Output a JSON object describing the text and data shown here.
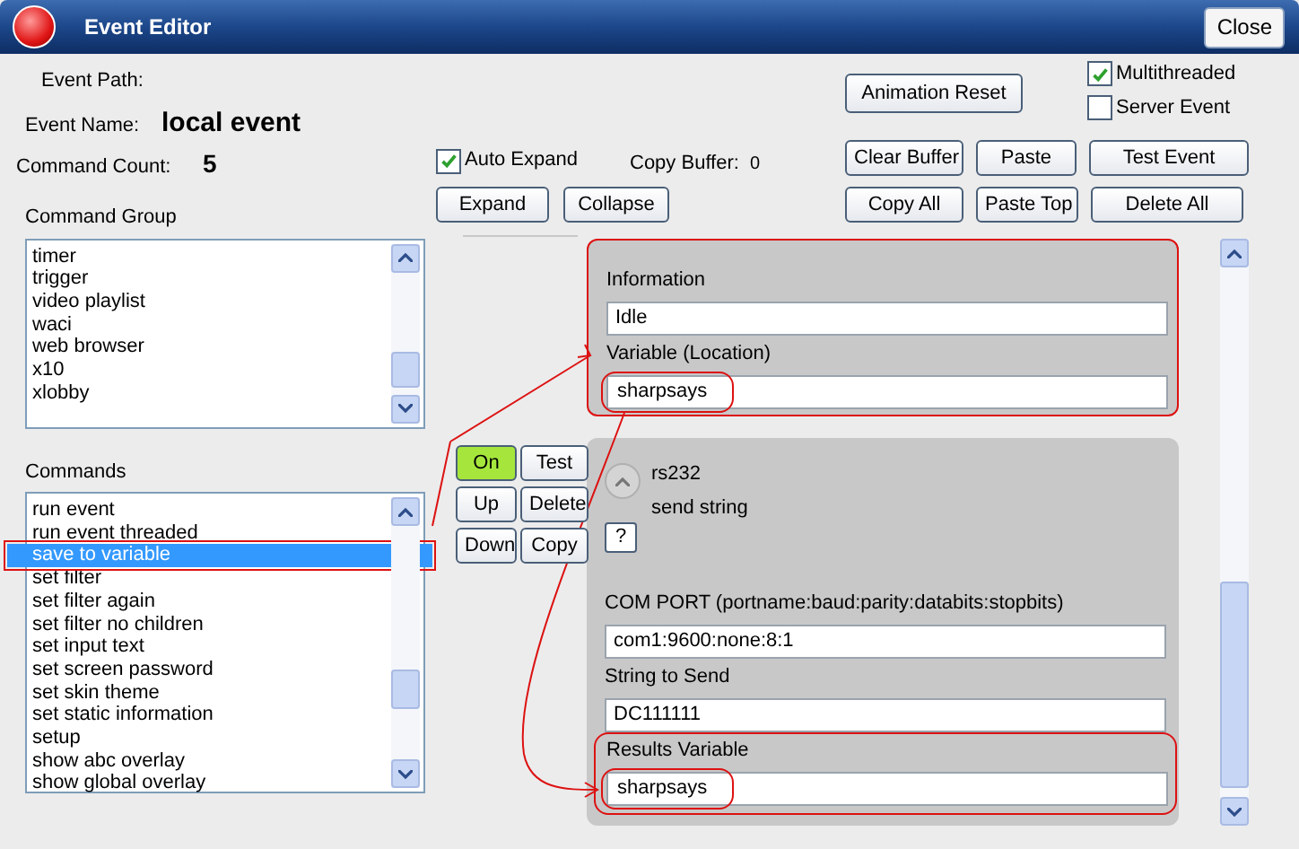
{
  "window": {
    "title": "Event Editor",
    "close_button": "Close"
  },
  "event": {
    "path_label": "Event Path:",
    "name_label": "Event Name:",
    "name": "local event",
    "count_label": "Command Count:",
    "count": "5"
  },
  "command_group": {
    "label": "Command Group",
    "items": [
      {
        "text": "timer",
        "selected": false,
        "marked": false
      },
      {
        "text": "trigger",
        "selected": false,
        "marked": false
      },
      {
        "text": "video playlist",
        "selected": false,
        "marked": false
      },
      {
        "text": "waci",
        "selected": false,
        "marked": false
      },
      {
        "text": "web browser",
        "selected": false,
        "marked": false
      },
      {
        "text": "x10",
        "selected": false,
        "marked": false
      },
      {
        "text": "xlobby",
        "selected": false,
        "marked": false
      }
    ]
  },
  "commands": {
    "label": "Commands",
    "items": [
      {
        "text": "run event",
        "selected": false,
        "marked": false
      },
      {
        "text": "run event threaded",
        "selected": false,
        "marked": false
      },
      {
        "text": "save to variable",
        "selected": true,
        "marked": true
      },
      {
        "text": "set filter",
        "selected": false,
        "marked": false
      },
      {
        "text": "set filter again",
        "selected": false,
        "marked": false
      },
      {
        "text": "set filter no children",
        "selected": false,
        "marked": false
      },
      {
        "text": "set input text",
        "selected": false,
        "marked": false
      },
      {
        "text": "set screen password",
        "selected": false,
        "marked": false
      },
      {
        "text": "set skin theme",
        "selected": false,
        "marked": false
      },
      {
        "text": "set static information",
        "selected": false,
        "marked": false
      },
      {
        "text": "setup",
        "selected": false,
        "marked": false
      },
      {
        "text": "show abc overlay",
        "selected": false,
        "marked": false
      },
      {
        "text": "show global overlay",
        "selected": false,
        "marked": false
      }
    ]
  },
  "animation_reset": "Animation Reset",
  "flags": [
    {
      "label": "Multithreaded",
      "checked": true
    },
    {
      "label": "Server Event",
      "checked": false
    }
  ],
  "auto_expand": {
    "label": "Auto Expand",
    "checked": true
  },
  "copy_buffer": {
    "label": "Copy Buffer:",
    "value": "0"
  },
  "view_buttons": [
    "Expand",
    "Collapse"
  ],
  "buffer_buttons": [
    [
      "Clear Buffer",
      "Paste",
      "Test Event"
    ],
    [
      "Copy All",
      "Paste Top",
      "Delete All"
    ]
  ],
  "command_buttons": [
    {
      "label": "On",
      "on": true
    },
    {
      "label": "Test"
    },
    {
      "label": "Up"
    },
    {
      "label": "Delete"
    },
    {
      "label": "Down"
    },
    {
      "label": "Copy"
    }
  ],
  "panels": [
    {
      "kind": "fields",
      "highlighted": true,
      "fields": [
        {
          "label": "Information",
          "value": "Idle",
          "highlighted": false,
          "value_marked": false
        },
        {
          "label": "Variable (Location)",
          "value": "sharpsays",
          "highlighted": false,
          "value_marked": true
        }
      ]
    },
    {
      "kind": "command",
      "highlighted": false,
      "title": "rs232",
      "subtitle": "send string",
      "help_button": "?",
      "fields": [
        {
          "label": "COM PORT (portname:baud:parity:databits:stopbits)",
          "value": "com1:9600:none:8:1",
          "highlighted": false,
          "value_marked": false
        },
        {
          "label": "String to Send",
          "value": "DC111111",
          "highlighted": false,
          "value_marked": false
        },
        {
          "label": "Results Variable",
          "value": "sharpsays",
          "highlighted": true,
          "value_marked": true
        }
      ]
    }
  ]
}
